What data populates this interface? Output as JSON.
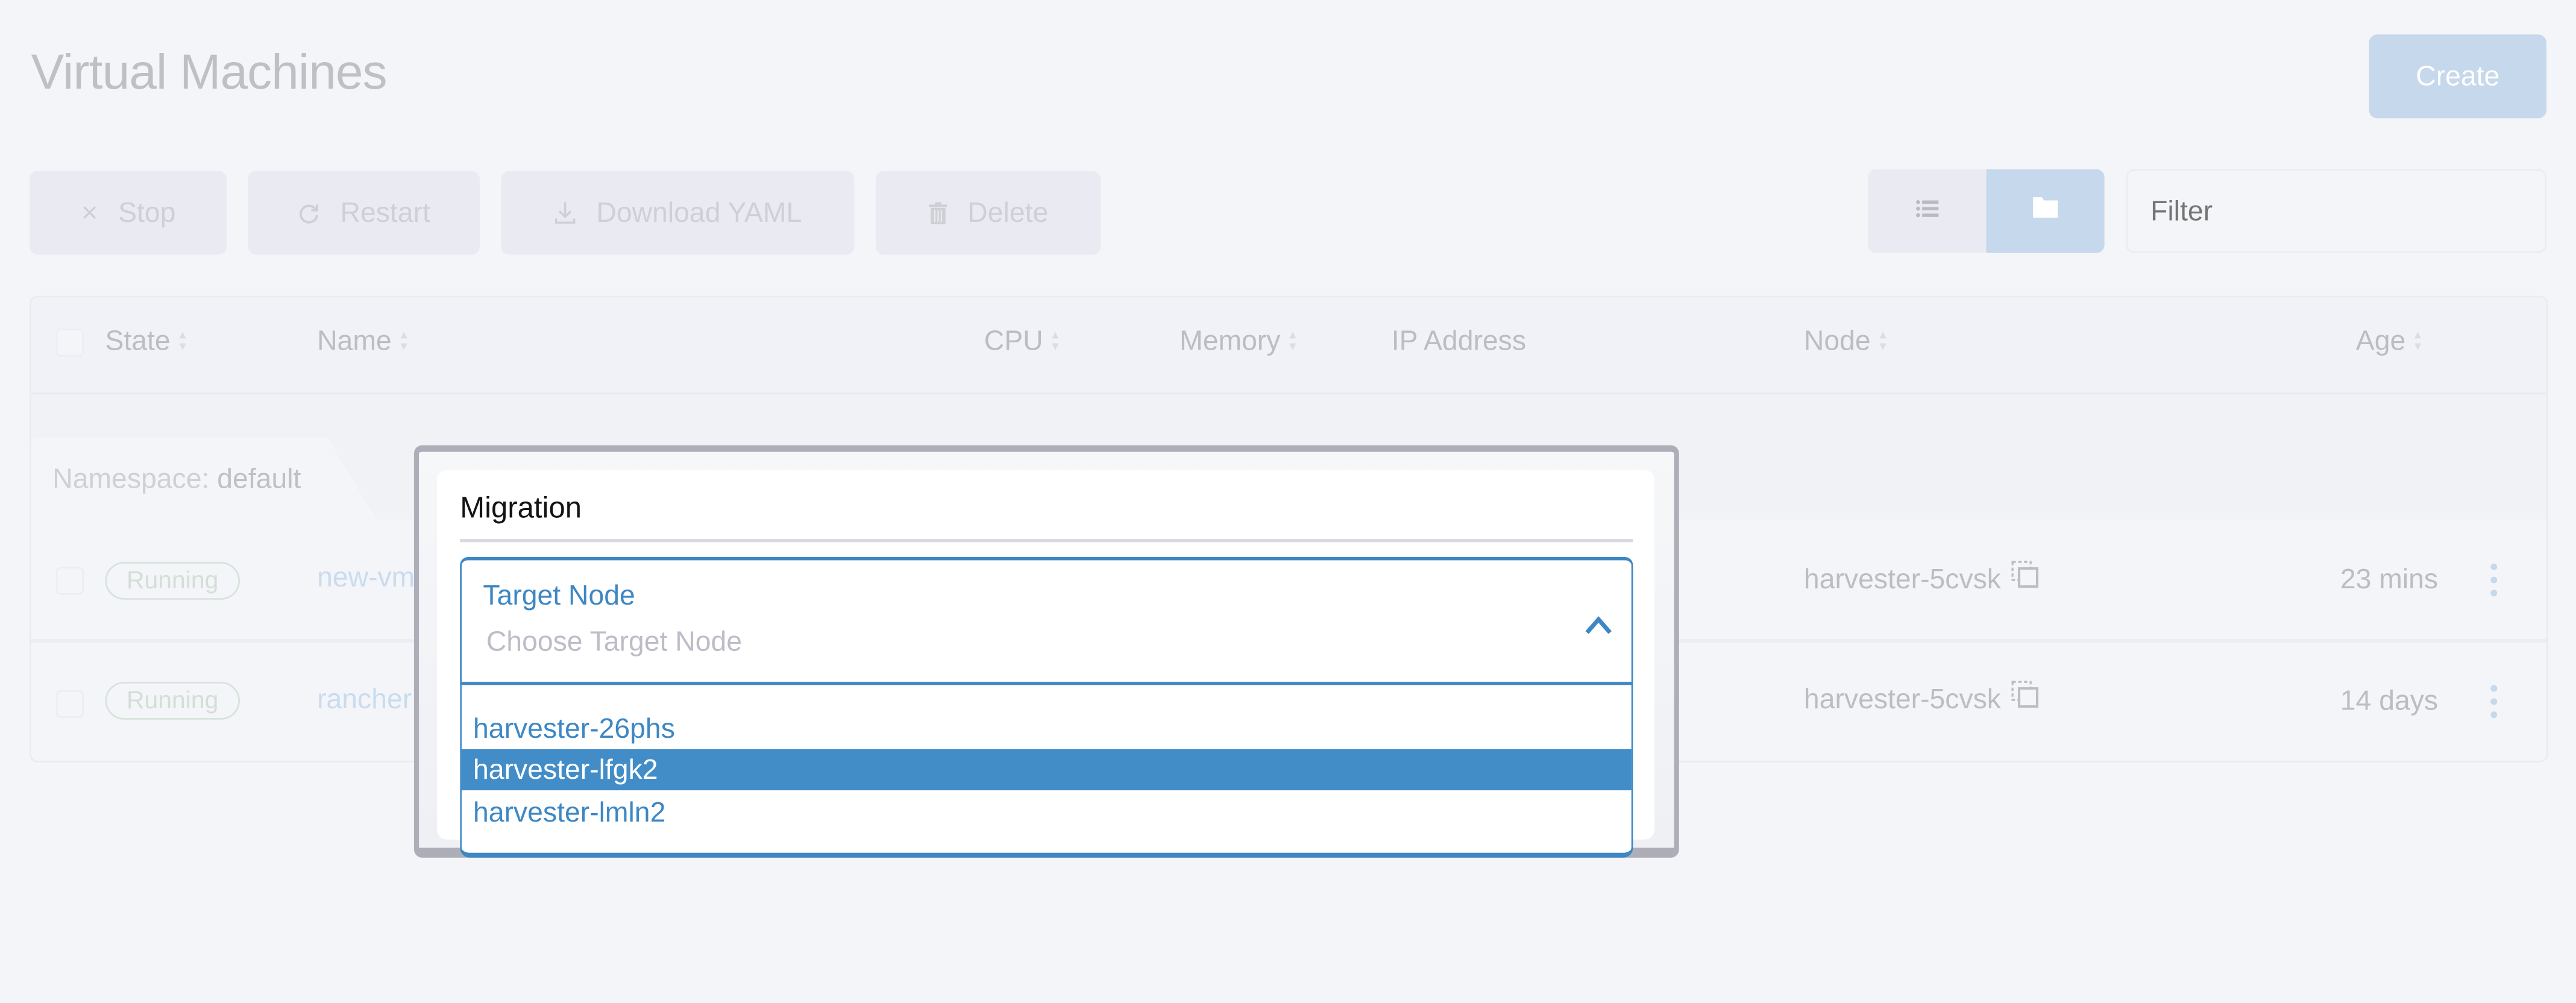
{
  "page": {
    "title": "Virtual Machines",
    "create_label": "Create"
  },
  "toolbar": {
    "buttons": [
      {
        "label": "Stop",
        "icon": "close-icon"
      },
      {
        "label": "Restart",
        "icon": "refresh-icon"
      },
      {
        "label": "Download YAML",
        "icon": "download-icon"
      },
      {
        "label": "Delete",
        "icon": "trash-icon"
      }
    ],
    "view_modes": [
      {
        "name": "flat-list",
        "icon": "list-icon",
        "active": false
      },
      {
        "name": "group-by-namespace",
        "icon": "folder-icon",
        "active": true
      }
    ],
    "filter_placeholder": "Filter",
    "filter_value": ""
  },
  "table": {
    "columns": [
      {
        "label": "State",
        "sortable": true
      },
      {
        "label": "Name",
        "sortable": true
      },
      {
        "label": "CPU",
        "sortable": true
      },
      {
        "label": "Memory",
        "sortable": true
      },
      {
        "label": "IP Address",
        "sortable": false
      },
      {
        "label": "Node",
        "sortable": true
      },
      {
        "label": "Age",
        "sortable": true
      }
    ],
    "group": {
      "prefix": "Namespace:",
      "value": "default"
    },
    "rows": [
      {
        "state": "Running",
        "name": "new-vm",
        "node": "harvester-5cvsk",
        "age": "23 mins"
      },
      {
        "state": "Running",
        "name": "rancher",
        "node": "harvester-5cvsk",
        "age": "14 days"
      }
    ]
  },
  "modal": {
    "title": "Migration",
    "field_label": "Target Node",
    "placeholder": "Choose Target Node",
    "options": [
      {
        "label": "harvester-26phs",
        "highlighted": false
      },
      {
        "label": "harvester-lfgk2",
        "highlighted": true
      },
      {
        "label": "harvester-lmln2",
        "highlighted": false
      }
    ]
  },
  "colors": {
    "accent": "#3d87c4",
    "highlight": "#428dc8",
    "primary_disabled": "#c6d8eb",
    "running_badge": "#d6e3da"
  }
}
